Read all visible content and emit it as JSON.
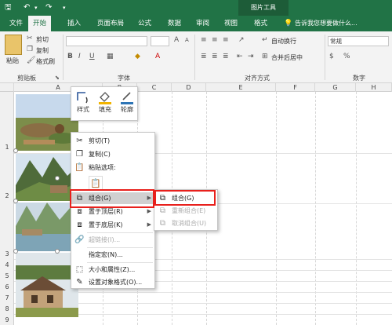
{
  "titlebar": {
    "undo_icon": "undo-icon",
    "redo_icon": "redo-icon",
    "context_tab": "图片工具"
  },
  "tabs": [
    "文件",
    "开始",
    "插入",
    "页面布局",
    "公式",
    "数据",
    "审阅",
    "视图",
    "格式"
  ],
  "active_tab": "开始",
  "tell_me": "告诉我您想要做什么...",
  "ribbon": {
    "clipboard": {
      "paste": "粘贴",
      "cut": "剪切",
      "copy": "复制",
      "format_painter": "格式刷",
      "group": "剪贴板"
    },
    "font": {
      "group": "字体"
    },
    "alignment": {
      "wrap": "自动换行",
      "merge": "合并后居中",
      "group": "对齐方式"
    },
    "number": {
      "format": "常规",
      "group": "数字"
    }
  },
  "columns": [
    "A",
    "B",
    "C",
    "D",
    "E",
    "F",
    "G",
    "H"
  ],
  "rows": [
    "1",
    "2",
    "3",
    "4",
    "5",
    "6",
    "7",
    "8",
    "9"
  ],
  "minibar": {
    "style": "样式",
    "fill": "填充",
    "outline": "轮廓"
  },
  "context_menu": {
    "cut": "剪切(T)",
    "copy": "复制(C)",
    "paste_options": "粘贴选项:",
    "group": "组合(G)",
    "bring_front": "置于顶层(R)",
    "send_back": "置于底层(K)",
    "hyperlink": "超链接(I)...",
    "assign_macro": "指定宏(N)...",
    "size_props": "大小和属性(Z)...",
    "format_object": "设置对象格式(O)..."
  },
  "submenu": {
    "group": "组合(G)",
    "regroup": "重新组合(E)",
    "ungroup": "取消组合(U)"
  },
  "highlight_color": "#e8201c",
  "excel_green": "#217346"
}
